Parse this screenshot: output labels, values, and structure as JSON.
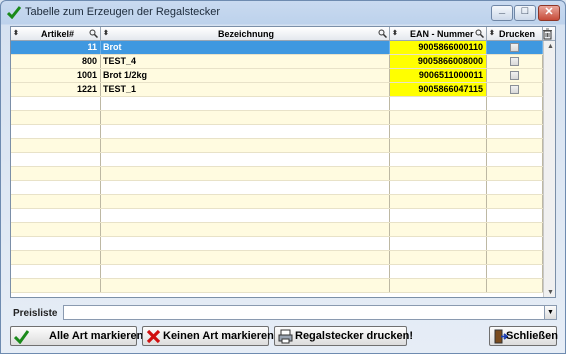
{
  "window": {
    "title": "Tabelle zum Erzeugen der Regalstecker"
  },
  "table": {
    "columns": [
      {
        "key": "artikel",
        "label": "Artikel#"
      },
      {
        "key": "bezeichnung",
        "label": "Bezeichnung"
      },
      {
        "key": "ean",
        "label": "EAN - Nummer"
      },
      {
        "key": "drucken",
        "label": "Drucken"
      }
    ],
    "rows": [
      {
        "artikel": "11",
        "bezeichnung": "Brot",
        "ean": "9005866000110",
        "drucken": false,
        "selected": true
      },
      {
        "artikel": "800",
        "bezeichnung": "TEST_4",
        "ean": "9005866008000",
        "drucken": false,
        "selected": false
      },
      {
        "artikel": "1001",
        "bezeichnung": "Brot 1/2kg",
        "ean": "9006511000011",
        "drucken": false,
        "selected": false
      },
      {
        "artikel": "1221",
        "bezeichnung": "TEST_1",
        "ean": "9005866047115",
        "drucken": false,
        "selected": false
      }
    ],
    "selected_color": "#3f98e0",
    "ean_highlight_color": "#ffff00"
  },
  "footer": {
    "preisliste_label": "Preisliste",
    "preisliste_value": ""
  },
  "buttons": {
    "alle": "Alle Art markieren",
    "keinen": "Keinen Art markieren",
    "drucken": "Regalstecker drucken!",
    "schliessen": "Schließen"
  },
  "icons": {
    "title": "checkmark-icon",
    "alle": "checkmark-icon",
    "keinen": "red-x-icon",
    "drucken": "printer-icon",
    "schliessen": "exit-door-icon"
  }
}
